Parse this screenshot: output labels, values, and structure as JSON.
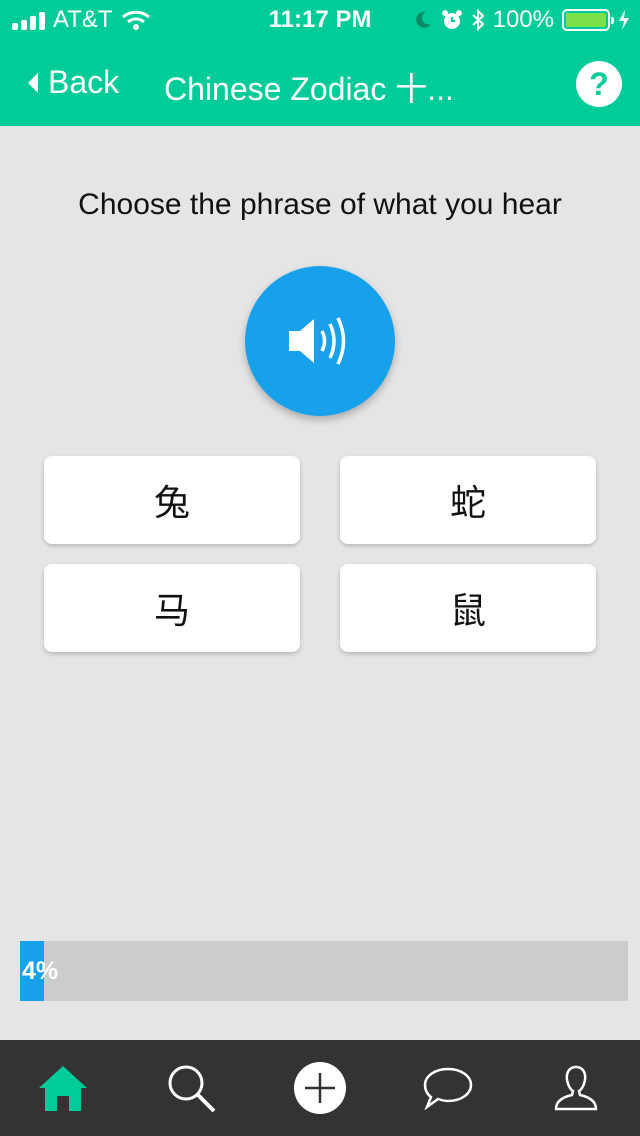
{
  "status_bar": {
    "carrier": "AT&T",
    "time": "11:17 PM",
    "battery": "100%",
    "icons": [
      "signal-icon",
      "wifi-icon",
      "moon-icon",
      "alarm-icon",
      "bluetooth-icon",
      "battery-icon",
      "charging-icon"
    ]
  },
  "nav": {
    "back_label": "Back",
    "title": "Chinese Zodiac 十...",
    "help_label": "?"
  },
  "exercise": {
    "prompt": "Choose the phrase of what you hear",
    "speaker_icon": "speaker-icon",
    "answers": [
      "兔",
      "蛇",
      "马",
      "鼠"
    ]
  },
  "progress": {
    "label": "4%",
    "fraction": 0.04
  },
  "tabbar": {
    "items": [
      "home-icon",
      "search-icon",
      "add-icon",
      "chat-icon",
      "profile-icon"
    ],
    "active": "home-icon"
  },
  "colors": {
    "accent": "#00cc99",
    "speaker": "#17a1ea",
    "progress_fill": "#17a1ea",
    "tabbar_bg": "#333333"
  }
}
